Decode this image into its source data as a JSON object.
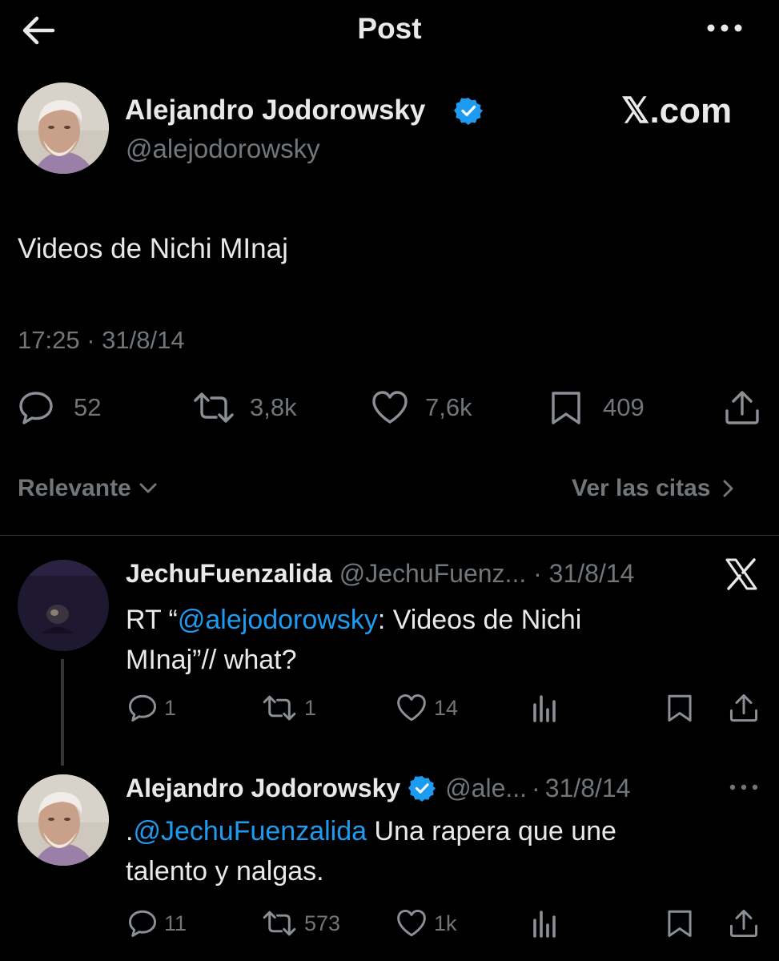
{
  "header": {
    "title": "Post",
    "back_icon": "arrow-left-icon",
    "more_icon": "more-horizontal-icon"
  },
  "post": {
    "author_name": "Alejandro Jodorowsky",
    "handle": "@alejodorowsky",
    "watermark": "𝕏.com",
    "text": "Videos de Nichi MInaj",
    "time": "17:25",
    "separator": "·",
    "date": "31/8/14",
    "stats": {
      "replies": "52",
      "reposts": "3,8k",
      "likes": "7,6k",
      "bookmarks": "409"
    }
  },
  "filter": {
    "sort_label": "Relevante",
    "quotes_label": "Ver las citas"
  },
  "replies": [
    {
      "author_name": "JechuFuenzalida",
      "handle": "@JechuFuenz...",
      "separator": "·",
      "date": "31/8/14",
      "source_icon": "x-logo-icon",
      "text_prefix": "RT “",
      "mention": "@alejodorowsky",
      "text_line1_suffix": ": Videos de Nichi",
      "text_line2": "MInaj”// what?",
      "stats": {
        "replies": "1",
        "reposts": "1",
        "likes": "14"
      }
    },
    {
      "author_name": "Alejandro Jodorowsky",
      "handle": "@ale...",
      "separator": "·",
      "date": "31/8/14",
      "text_prefix": ".",
      "mention": "@JechuFuenzalida",
      "text_line1_suffix": " Una rapera que une",
      "text_line2": "talento y nalgas.",
      "stats": {
        "replies": "11",
        "reposts": "573",
        "likes": "1k"
      }
    }
  ],
  "colors": {
    "background": "#000000",
    "text": "#e7e9ea",
    "secondary": "#71767b",
    "accent": "#1d9bf0",
    "divider": "#2f3336"
  }
}
